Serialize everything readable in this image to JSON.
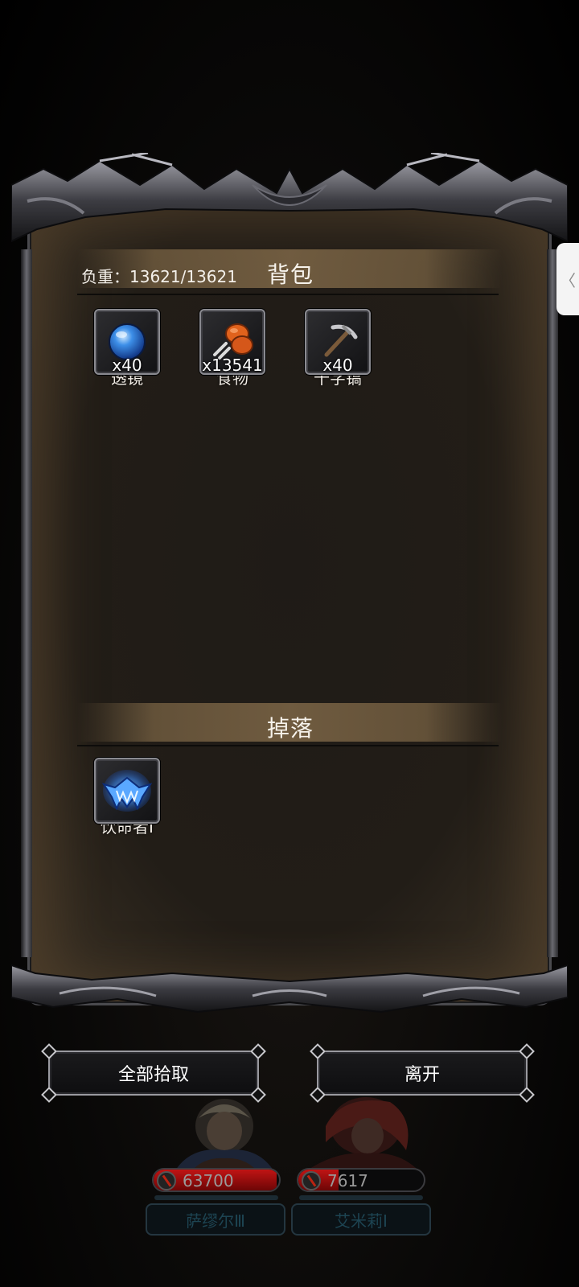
{
  "bag": {
    "weight_label": "负重",
    "weight_colon": "：",
    "weight_value": "13621/13621",
    "title": "背包",
    "items": [
      {
        "qty": "x40",
        "name": "透镜",
        "icon": "blue-orb-lens-icon"
      },
      {
        "qty": "x13541",
        "name": "食物",
        "icon": "meat-drumstick-food-icon"
      },
      {
        "qty": "x40",
        "name": "十字镐",
        "icon": "pickaxe-icon"
      }
    ]
  },
  "drop": {
    "title": "掉落",
    "items": [
      {
        "name": "饮命者Ⅰ",
        "icon": "blue-fanged-mask-icon"
      }
    ]
  },
  "buttons": {
    "pickup_all": "全部拾取",
    "leave": "离开"
  },
  "heroes": [
    {
      "hp": "63700",
      "hp_fraction": 0.98,
      "name": "萨缪尔Ⅲ"
    },
    {
      "hp": "7617",
      "hp_fraction": 0.32,
      "name": "艾米莉Ⅰ"
    }
  ],
  "side_tab": {
    "glyph": "〈"
  },
  "colors": {
    "hp_red": "#c01414",
    "panel_brown": "#221d17",
    "frame_metal": "#8a8a90"
  }
}
